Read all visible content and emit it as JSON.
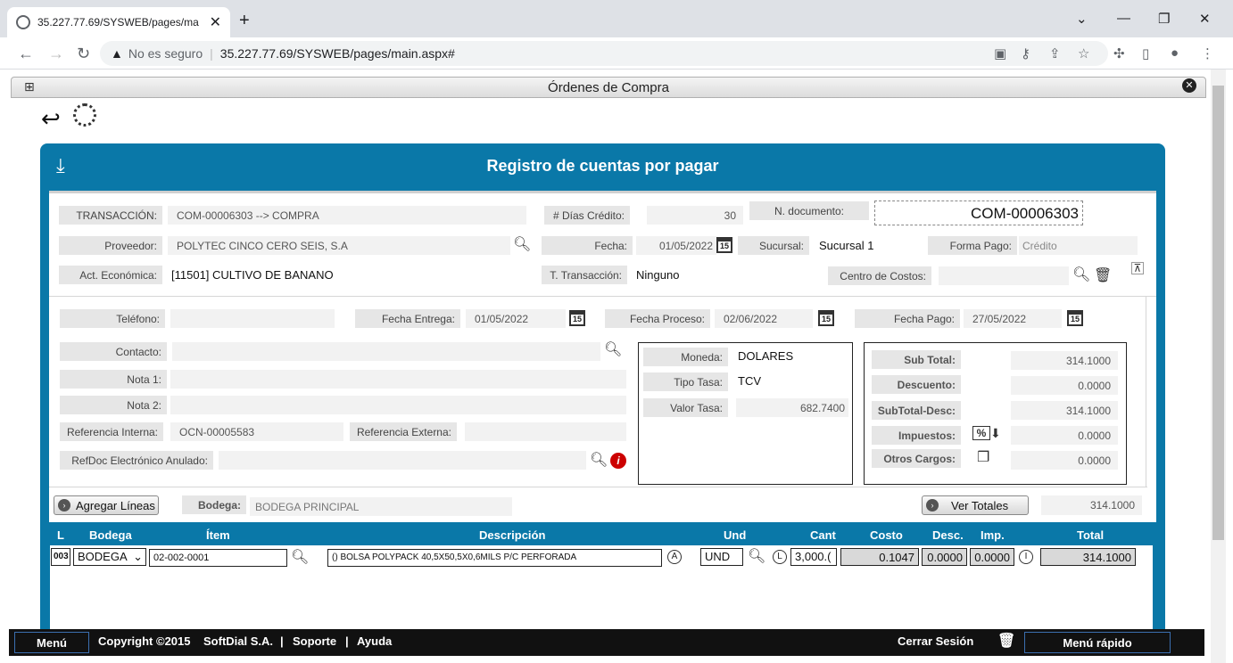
{
  "browser": {
    "tab_title": "35.227.77.69/SYSWEB/pages/ma",
    "not_secure": "No es seguro",
    "url": "35.227.77.69/SYSWEB/pages/main.aspx#"
  },
  "app": {
    "window_title": "Órdenes de Compra",
    "panel_title": "Registro de cuentas por pagar"
  },
  "header": {
    "transaccion_label": "TRANSACCIÓN:",
    "transaccion_value": "COM-00006303 --> COMPRA",
    "dias_credito_label": "# Días Crédito:",
    "dias_credito_value": "30",
    "n_documento_label": "N. documento:",
    "n_documento_value": "COM-00006303",
    "proveedor_label": "Proveedor:",
    "proveedor_value": "POLYTEC CINCO CERO SEIS, S.A",
    "fecha_label": "Fecha:",
    "fecha_value": "01/05/2022",
    "sucursal_label": "Sucursal:",
    "sucursal_value": "Sucursal 1",
    "forma_pago_label": "Forma Pago:",
    "forma_pago_value": "Crédito",
    "act_economica_label": "Act. Económica:",
    "act_economica_value": "[11501] CULTIVO DE BANANO",
    "t_transaccion_label": "T. Transacción:",
    "t_transaccion_value": "Ninguno",
    "centro_costos_label": "Centro de Costos:"
  },
  "detail": {
    "telefono_label": "Teléfono:",
    "fecha_entrega_label": "Fecha Entrega:",
    "fecha_entrega_value": "01/05/2022",
    "fecha_proceso_label": "Fecha Proceso:",
    "fecha_proceso_value": "02/06/2022",
    "fecha_pago_label": "Fecha Pago:",
    "fecha_pago_value": "27/05/2022",
    "contacto_label": "Contacto:",
    "nota1_label": "Nota 1:",
    "nota2_label": "Nota 2:",
    "ref_interna_label": "Referencia Interna:",
    "ref_interna_value": "OCN-00005583",
    "ref_externa_label": "Referencia Externa:",
    "refdoc_label": "RefDoc Electrónico Anulado:"
  },
  "currency": {
    "moneda_label": "Moneda:",
    "moneda_value": "DOLARES",
    "tipo_tasa_label": "Tipo Tasa:",
    "tipo_tasa_value": "TCV",
    "valor_tasa_label": "Valor Tasa:",
    "valor_tasa_value": "682.7400"
  },
  "totals": {
    "subtotal_label": "Sub Total:",
    "subtotal_value": "314.1000",
    "descuento_label": "Descuento:",
    "descuento_value": "0.0000",
    "subtotal_desc_label": "SubTotal-Desc:",
    "subtotal_desc_value": "314.1000",
    "impuestos_label": "Impuestos:",
    "impuestos_value": "0.0000",
    "otros_cargos_label": "Otros Cargos:",
    "otros_cargos_value": "0.0000",
    "impuestos_icon_text": "%"
  },
  "lines_bar": {
    "agregar_label": "Agregar Líneas",
    "bodega_label": "Bodega:",
    "bodega_value": "BODEGA PRINCIPAL",
    "ver_totales_label": "Ver Totales",
    "total_value": "314.1000"
  },
  "grid": {
    "columns": [
      "L",
      "Bodega",
      "Ítem",
      "Descripción",
      "Und",
      "Cant",
      "Costo",
      "Desc.",
      "Imp.",
      "Total"
    ],
    "row": {
      "line": "003",
      "bodega": "BODEGA",
      "item": "02-002-0001",
      "descripcion": "() BOLSA POLYPACK 40,5X50,5X0,6MILS P/C PERFORADA",
      "desc_badge": "A",
      "und": "UND",
      "und_badge": "L",
      "cant": "3,000.(",
      "costo": "0.1047",
      "desc": "0.0000",
      "imp": "0.0000",
      "imp_badge": "I",
      "total": "314.1000"
    }
  },
  "footer": {
    "menu": "Menú",
    "copyright": "Copyright ©2015",
    "company": "SoftDial S.A.",
    "soporte": "Soporte",
    "ayuda": "Ayuda",
    "cerrar_sesion": "Cerrar Sesión",
    "menu_rapido": "Menú rápido"
  },
  "calendar_day": "15"
}
